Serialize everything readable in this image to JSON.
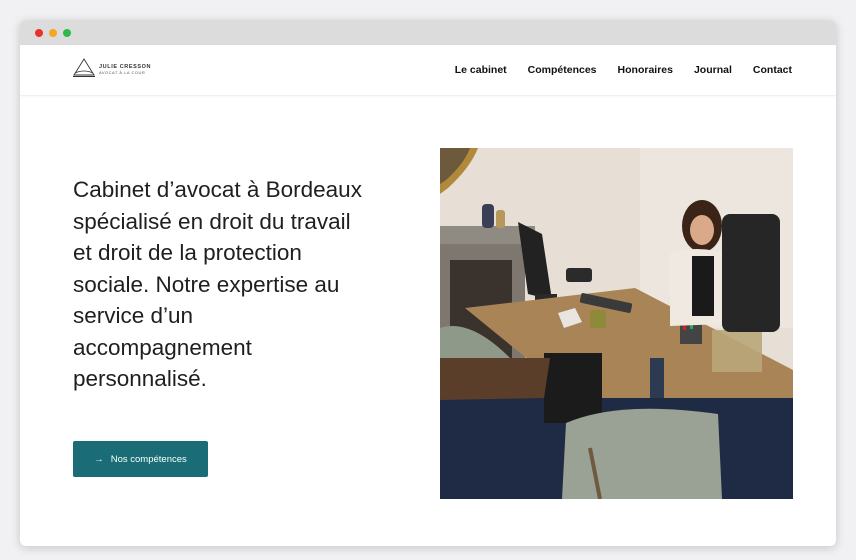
{
  "window": {
    "dots": [
      {
        "name": "close",
        "color": "#e8322e"
      },
      {
        "name": "minimize",
        "color": "#f5a623"
      },
      {
        "name": "maximize",
        "color": "#2fb84a"
      }
    ]
  },
  "header": {
    "logo": {
      "name": "JULIE CRESSON",
      "tagline": "AVOCAT À LA COUR",
      "icon": "triangle-logo-icon"
    },
    "nav": [
      {
        "key": "cabinet",
        "label": "Le cabinet"
      },
      {
        "key": "competences",
        "label": "Compétences"
      },
      {
        "key": "honoraires",
        "label": "Honoraires"
      },
      {
        "key": "journal",
        "label": "Journal"
      },
      {
        "key": "contact",
        "label": "Contact"
      }
    ]
  },
  "hero": {
    "headline": "Cabinet d’avocat à Bordeaux spécialisé en droit du travail et droit de la protection sociale. Notre expertise au service d’un accompagnement personnalisé.",
    "cta": {
      "icon": "→",
      "label": "Nos compétences",
      "color": "#1a6c76"
    },
    "photo": {
      "icon": "office-photo"
    }
  }
}
